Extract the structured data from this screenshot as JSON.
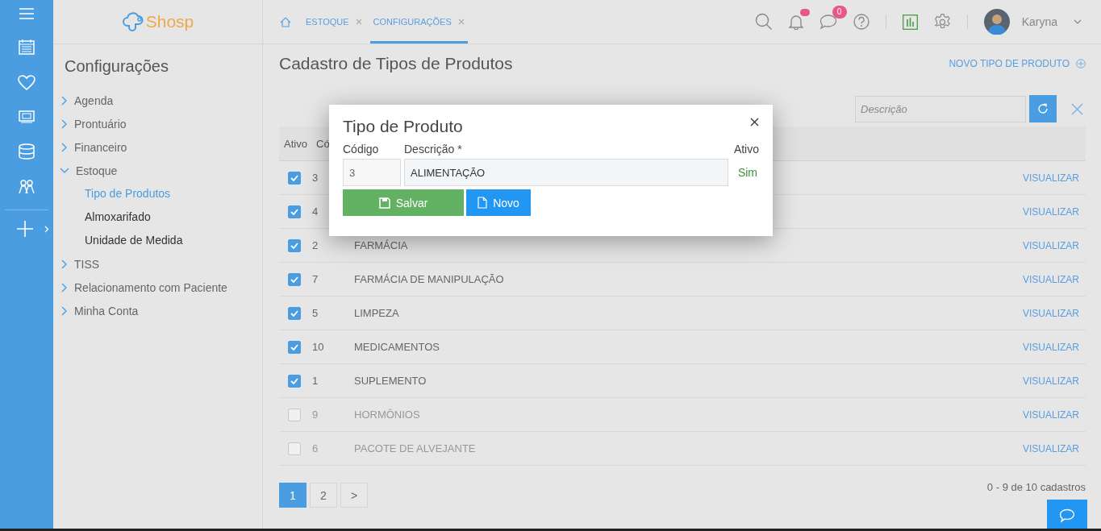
{
  "logo": {
    "text": "Shosp"
  },
  "sidebar": {
    "title": "Configurações",
    "items": [
      {
        "label": "Agenda",
        "expanded": false
      },
      {
        "label": "Prontuário",
        "expanded": false
      },
      {
        "label": "Financeiro",
        "expanded": false
      },
      {
        "label": "Estoque",
        "expanded": true,
        "children": [
          {
            "label": "Tipo de Produtos",
            "selected": true
          },
          {
            "label": "Almoxarifado",
            "selected": false
          },
          {
            "label": "Unidade de Medida",
            "selected": false
          }
        ]
      },
      {
        "label": "TISS",
        "expanded": false
      },
      {
        "label": "Relacionamento com Paciente",
        "expanded": false
      },
      {
        "label": "Minha Conta",
        "expanded": false
      }
    ]
  },
  "tabs": [
    {
      "label": "ESTOQUE",
      "selected": false
    },
    {
      "label": "CONFIGURAÇÕES",
      "selected": true
    }
  ],
  "header": {
    "messages_badge": "0",
    "user": "Karyna"
  },
  "page": {
    "title": "Cadastro de Tipos de Produtos",
    "new_link": "NOVO TIPO DE PRODUTO",
    "search": {
      "placeholder": "Descrição"
    }
  },
  "table": {
    "columns": [
      "Ativo",
      "Có"
    ],
    "rows": [
      {
        "active": true,
        "code": "3",
        "action": "VISUALIZAR"
      },
      {
        "active": true,
        "code": "4",
        "action": "VISUALIZAR"
      },
      {
        "active": true,
        "code": "2",
        "description": "FARMÁCIA",
        "action": "VISUALIZAR"
      },
      {
        "active": true,
        "code": "7",
        "description": "FARMÁCIA DE MANIPULAÇÃO",
        "action": "VISUALIZAR"
      },
      {
        "active": true,
        "code": "5",
        "description": "LIMPEZA",
        "action": "VISUALIZAR"
      },
      {
        "active": true,
        "code": "10",
        "description": "MEDICAMENTOS",
        "action": "VISUALIZAR"
      },
      {
        "active": true,
        "code": "1",
        "description": "SUPLEMENTO",
        "action": "VISUALIZAR"
      },
      {
        "active": false,
        "code": "9",
        "description": "HORMÔNIOS",
        "action": "VISUALIZAR"
      },
      {
        "active": false,
        "code": "6",
        "description": "PACOTE DE ALVEJANTE",
        "action": "VISUALIZAR"
      }
    ]
  },
  "pagination": {
    "pages": [
      {
        "label": "1",
        "selected": true
      },
      {
        "label": "2",
        "selected": false
      },
      {
        "label": ">",
        "selected": false
      }
    ],
    "summary": "0 - 9 de 10 cadastros"
  },
  "modal": {
    "title": "Tipo de Produto",
    "code_label": "Código",
    "code_value": "3",
    "description_label": "Descrição *",
    "description_value": "ALIMENTAÇÃO",
    "active_label": "Ativo",
    "active_value": "Sim",
    "save_button": "Salvar",
    "new_button": "Novo"
  }
}
